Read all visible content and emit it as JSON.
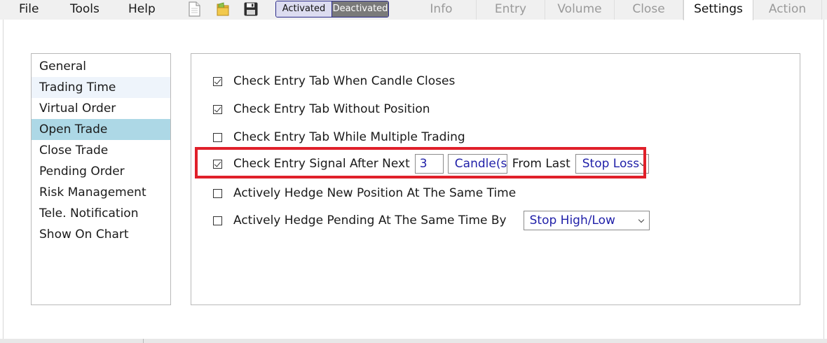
{
  "menu": {
    "file": "File",
    "tools": "Tools",
    "help": "Help"
  },
  "toolbar_icons": [
    "new-document-icon",
    "open-folder-icon",
    "save-disk-icon"
  ],
  "toggle": {
    "activated": "Activated",
    "deactivated": "Deactivated",
    "state": "Deactivated"
  },
  "tabs": [
    {
      "label": "Info"
    },
    {
      "label": "Entry"
    },
    {
      "label": "Volume"
    },
    {
      "label": "Close"
    },
    {
      "label": "Settings",
      "active": true
    },
    {
      "label": "Action"
    }
  ],
  "sidebar": {
    "items": [
      {
        "label": "General"
      },
      {
        "label": "Trading Time"
      },
      {
        "label": "Virtual Order"
      },
      {
        "label": "Open Trade",
        "selected": true
      },
      {
        "label": "Close Trade"
      },
      {
        "label": "Pending Order"
      },
      {
        "label": "Risk Management"
      },
      {
        "label": "Tele. Notification"
      },
      {
        "label": "Show On Chart"
      }
    ]
  },
  "settings": {
    "row1": {
      "label": "Check Entry Tab When Candle Closes",
      "checked": true
    },
    "row2": {
      "label": "Check Entry Tab Without Position",
      "checked": true
    },
    "row3": {
      "label": "Check Entry Tab While Multiple Trading",
      "checked": false
    },
    "row4": {
      "label": "Check Entry Signal After Next",
      "checked": true,
      "count_value": "3",
      "unit_value": "Candle(s",
      "mid_label": "From Last",
      "reference_value": "Stop Loss"
    },
    "row5": {
      "label": "Actively Hedge New Position At The Same Time",
      "checked": false
    },
    "row6": {
      "label": "Actively Hedge Pending At The Same Time By",
      "checked": false,
      "select_value": "Stop High/Low"
    }
  },
  "colors": {
    "accent_highlight": "#e0202a",
    "selected_item": "#add8e6",
    "value_text": "#1f1fa8"
  }
}
